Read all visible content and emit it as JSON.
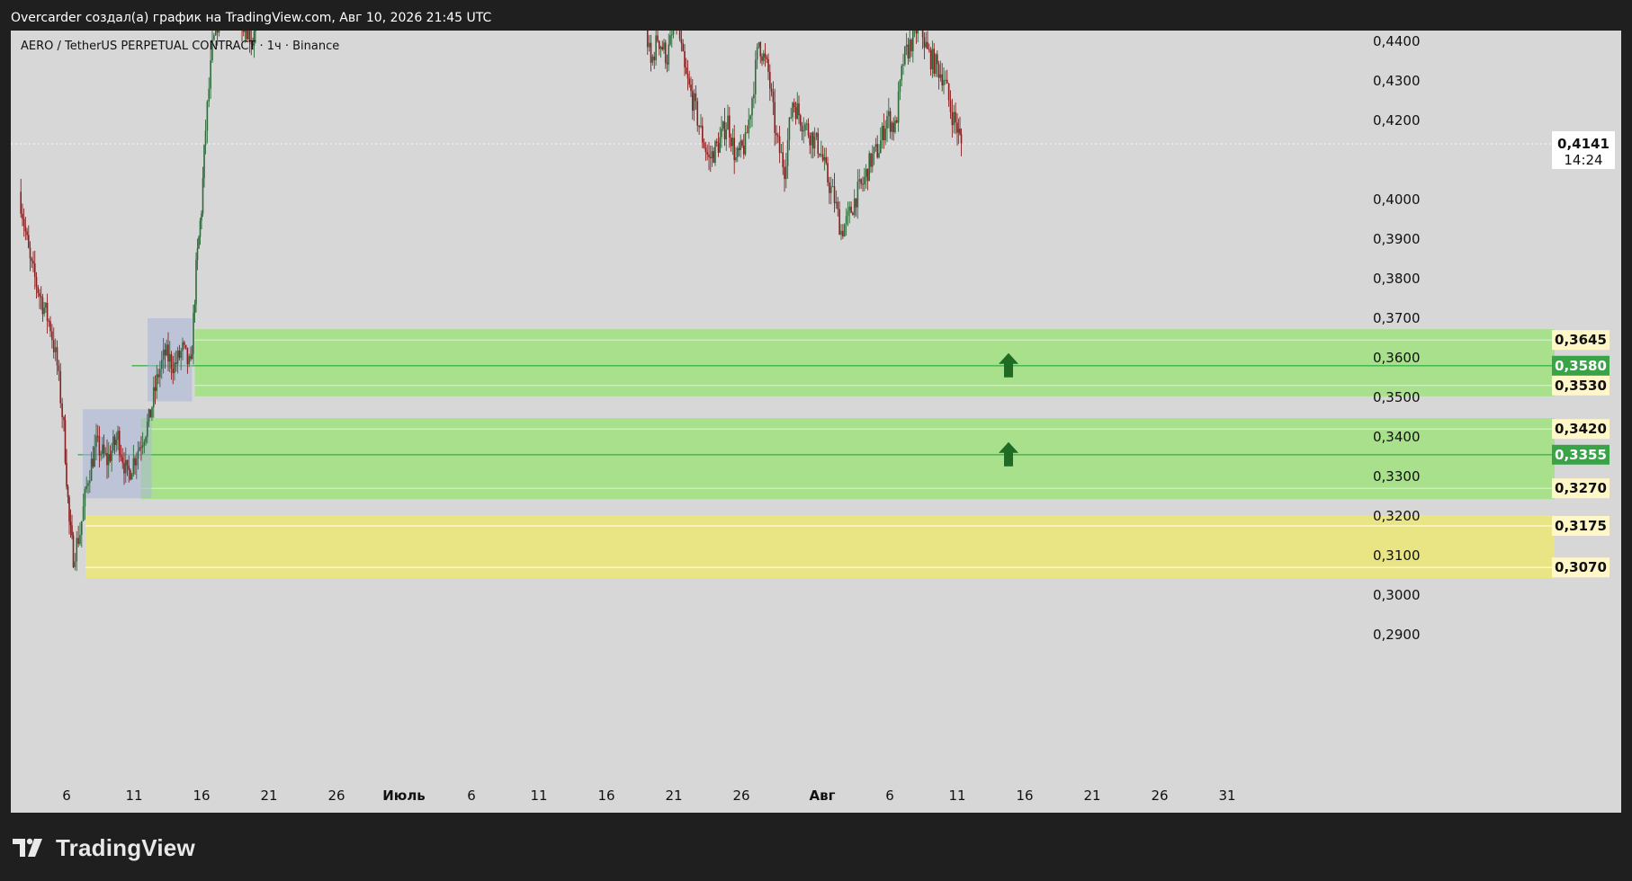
{
  "caption": "Overcarder создал(а) график на TradingView.com, Авг 10, 2026 21:45 UTC",
  "brand": {
    "name": "TradingView"
  },
  "chart_data": {
    "type": "candlestick",
    "symbol_label": "AERO / TetherUS PERPETUAL CONTRACT · 1ч · Binance",
    "colors": {
      "background": "#d7d7d7",
      "candle_up": "#2e6b3a",
      "candle_down": "#8b1e1e",
      "demand_zone_fill": "#a8e08c",
      "demand_zone_line": "#3bb54a",
      "yellow_zone_fill": "#e9e585",
      "yellow_zone_edge": "#fffbe0",
      "arrow": "#1f6b24",
      "profile": "#aab4d8"
    },
    "yaxis": {
      "ylim": [
        0.2815,
        0.4525
      ],
      "ticks": [
        "0,4400",
        "0,4300",
        "0,4200",
        "0,4000",
        "0,3900",
        "0,3800",
        "0,3700",
        "0,3600",
        "0,3500",
        "0,3400",
        "0,3300",
        "0,3200",
        "0,3100",
        "0,3000",
        "0,2900"
      ]
    },
    "xaxis": {
      "day_range": [
        2.5,
        37
      ],
      "ticks": [
        {
          "label": "6",
          "day": 6
        },
        {
          "label": "11",
          "day": 11
        },
        {
          "label": "16",
          "day": 16
        },
        {
          "label": "21",
          "day": 21
        },
        {
          "label": "26",
          "day": 26
        },
        {
          "label": "Июль",
          "day": 31
        },
        {
          "label": "6",
          "day": 36
        },
        {
          "label": "11",
          "day": 41
        },
        {
          "label": "16",
          "day": 46
        },
        {
          "label": "21",
          "day": 51
        },
        {
          "label": "26",
          "day": 56
        },
        {
          "label": "Авг",
          "day": 62
        },
        {
          "label": "6",
          "day": 67
        },
        {
          "label": "11",
          "day": 72
        },
        {
          "label": "16",
          "day": 77
        },
        {
          "label": "21",
          "day": 82
        },
        {
          "label": "26",
          "day": 87
        },
        {
          "label": "31",
          "day": 92
        }
      ]
    },
    "last_price": {
      "value": 0.4141,
      "label": "0,4141",
      "countdown": "14:24"
    },
    "zones": [
      {
        "kind": "green",
        "top": 0.3645,
        "mid": 0.358,
        "bottom": 0.353,
        "start_day": 15.5,
        "top_label": "0,3645",
        "mid_label": "0,3580",
        "bottom_label": "0,3530",
        "arrow_day": 75.8
      },
      {
        "kind": "green",
        "top": 0.342,
        "mid": 0.3355,
        "bottom": 0.327,
        "start_day": 11.5,
        "top_label": "0,3420",
        "mid_label": "0,3355",
        "bottom_label": "0,3270",
        "arrow_day": 75.8
      },
      {
        "kind": "yellow",
        "top": 0.3175,
        "bottom": 0.307,
        "start_day": 7.4,
        "top_label": "0,3175",
        "bottom_label": "0,3070"
      }
    ],
    "price_path": [
      [
        2.5,
        0.402
      ],
      [
        3.3,
        0.384
      ],
      [
        4.0,
        0.376
      ],
      [
        4.8,
        0.368
      ],
      [
        5.3,
        0.358
      ],
      [
        5.8,
        0.342
      ],
      [
        6.2,
        0.318
      ],
      [
        6.5,
        0.31
      ],
      [
        7.0,
        0.316
      ],
      [
        7.6,
        0.33
      ],
      [
        8.2,
        0.338
      ],
      [
        9.0,
        0.334
      ],
      [
        9.8,
        0.34
      ],
      [
        10.5,
        0.33
      ],
      [
        11.3,
        0.337
      ],
      [
        12.1,
        0.344
      ],
      [
        12.8,
        0.356
      ],
      [
        13.3,
        0.361
      ],
      [
        14.0,
        0.358
      ],
      [
        14.6,
        0.362
      ],
      [
        15.2,
        0.357
      ],
      [
        15.6,
        0.382
      ],
      [
        16.0,
        0.398
      ],
      [
        16.3,
        0.418
      ],
      [
        16.8,
        0.438
      ],
      [
        17.3,
        0.447
      ],
      [
        18.0,
        0.452
      ],
      [
        19.0,
        0.446
      ],
      [
        19.8,
        0.44
      ],
      [
        20.1,
        0.452
      ],
      [
        47.5,
        0.456
      ],
      [
        48.0,
        0.45
      ],
      [
        48.8,
        0.446
      ],
      [
        49.3,
        0.434
      ],
      [
        49.8,
        0.441
      ],
      [
        50.5,
        0.436
      ],
      [
        51.2,
        0.446
      ],
      [
        51.8,
        0.432
      ],
      [
        52.5,
        0.424
      ],
      [
        53.0,
        0.417
      ],
      [
        53.6,
        0.41
      ],
      [
        54.3,
        0.414
      ],
      [
        55.0,
        0.42
      ],
      [
        55.6,
        0.41
      ],
      [
        56.3,
        0.414
      ],
      [
        56.8,
        0.426
      ],
      [
        57.3,
        0.44
      ],
      [
        58.0,
        0.432
      ],
      [
        58.6,
        0.415
      ],
      [
        59.2,
        0.408
      ],
      [
        59.8,
        0.425
      ],
      [
        60.5,
        0.42
      ],
      [
        61.2,
        0.416
      ],
      [
        61.8,
        0.413
      ],
      [
        62.4,
        0.405
      ],
      [
        62.9,
        0.4
      ],
      [
        63.4,
        0.392
      ],
      [
        63.9,
        0.395
      ],
      [
        64.5,
        0.401
      ],
      [
        65.0,
        0.404
      ],
      [
        65.6,
        0.41
      ],
      [
        66.2,
        0.413
      ],
      [
        66.8,
        0.421
      ],
      [
        67.4,
        0.418
      ],
      [
        68.0,
        0.435
      ],
      [
        68.6,
        0.44
      ],
      [
        69.2,
        0.445
      ],
      [
        69.8,
        0.437
      ],
      [
        70.4,
        0.434
      ],
      [
        71.0,
        0.431
      ],
      [
        71.5,
        0.423
      ],
      [
        72.0,
        0.418
      ],
      [
        72.3,
        0.414
      ]
    ]
  }
}
